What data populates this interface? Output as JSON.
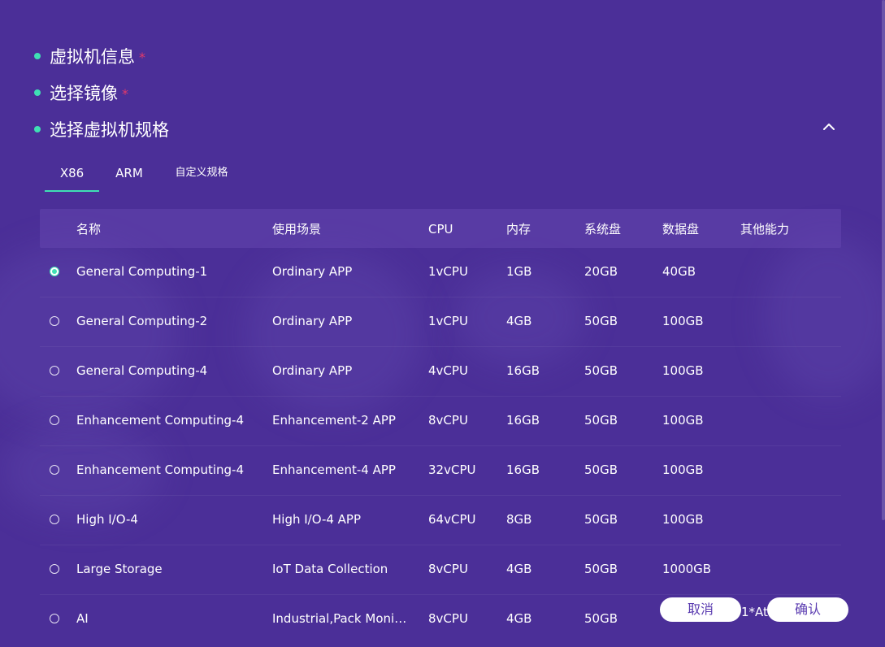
{
  "sections": [
    {
      "title": "虚拟机信息",
      "required": "*"
    },
    {
      "title": "选择镜像",
      "required": "*"
    },
    {
      "title": "选择虚拟机规格"
    }
  ],
  "tabs": [
    {
      "label": "X86",
      "active": true
    },
    {
      "label": "ARM"
    },
    {
      "label": "自定义规格"
    }
  ],
  "table": {
    "headers": [
      "名称",
      "使用场景",
      "CPU",
      "内存",
      "系统盘",
      "数据盘",
      "其他能力"
    ],
    "rows": [
      {
        "selected": true,
        "name": "General Computing-1",
        "scene": "Ordinary APP",
        "cpu": "1vCPU",
        "mem": "1GB",
        "sys": "20GB",
        "data": "40GB",
        "other": ""
      },
      {
        "selected": false,
        "name": "General Computing-2",
        "scene": "Ordinary APP",
        "cpu": "1vCPU",
        "mem": "4GB",
        "sys": "50GB",
        "data": "100GB",
        "other": ""
      },
      {
        "selected": false,
        "name": "General Computing-4",
        "scene": "Ordinary APP",
        "cpu": "4vCPU",
        "mem": "16GB",
        "sys": "50GB",
        "data": "100GB",
        "other": ""
      },
      {
        "selected": false,
        "name": "Enhancement Computing-4",
        "scene": "Enhancement-2 APP",
        "cpu": "8vCPU",
        "mem": "16GB",
        "sys": "50GB",
        "data": "100GB",
        "other": ""
      },
      {
        "selected": false,
        "name": "Enhancement Computing-4",
        "scene": "Enhancement-4 APP",
        "cpu": "32vCPU",
        "mem": "16GB",
        "sys": "50GB",
        "data": "100GB",
        "other": ""
      },
      {
        "selected": false,
        "name": "High I/O-4",
        "scene": "High I/O-4 APP",
        "cpu": "64vCPU",
        "mem": "8GB",
        "sys": "50GB",
        "data": "100GB",
        "other": ""
      },
      {
        "selected": false,
        "name": "Large Storage",
        "scene": "IoT Data Collection",
        "cpu": "8vCPU",
        "mem": "4GB",
        "sys": "50GB",
        "data": "1000GB",
        "other": ""
      },
      {
        "selected": false,
        "name": "AI",
        "scene": "Industrial,Pack Monit…",
        "cpu": "8vCPU",
        "mem": "4GB",
        "sys": "50GB",
        "data": "",
        "other": "1*Ati"
      }
    ]
  },
  "buttons": {
    "cancel": "取消",
    "confirm": "确认"
  },
  "colors": {
    "background": "#4b2f98",
    "accent": "#3fe0b4",
    "required": "#e23a6a",
    "button_text": "#5a3bb0"
  }
}
